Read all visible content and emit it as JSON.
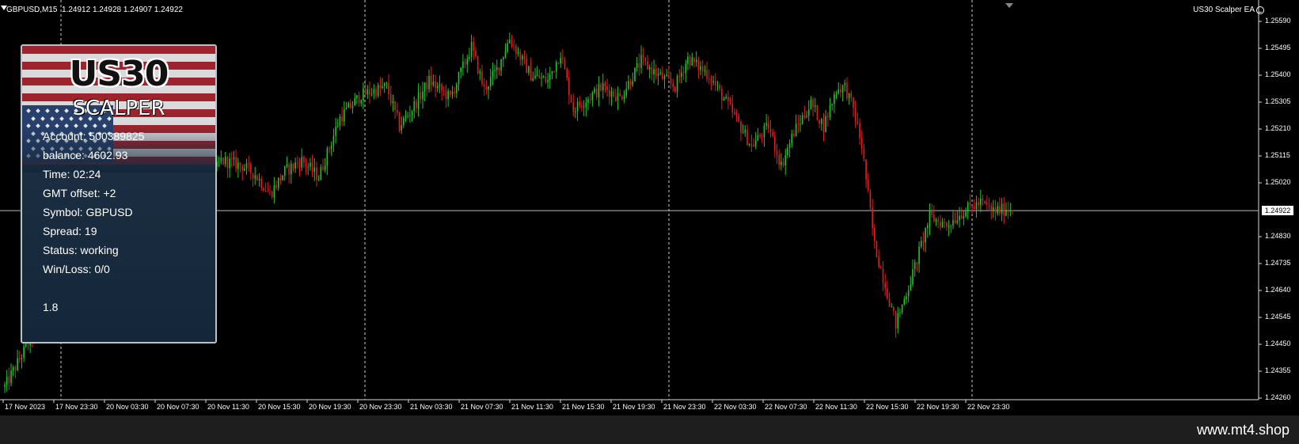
{
  "header": {
    "symbol": "GBPUSD,M15",
    "ohlc": "1.24912 1.24928 1.24907 1.24922",
    "ea_name": "US30 Scalper EA"
  },
  "price_axis": {
    "labels": [
      "1.25590",
      "1.25495",
      "1.25400",
      "1.25305",
      "1.25210",
      "1.25115",
      "1.25020",
      "1.24830",
      "1.24735",
      "1.24640",
      "1.24545",
      "1.24450",
      "1.24355",
      "1.24260"
    ],
    "current_price": "1.24922"
  },
  "time_axis": {
    "labels": [
      "17 Nov 2023",
      "17 Nov 23:30",
      "20 Nov 03:30",
      "20 Nov 07:30",
      "20 Nov 11:30",
      "20 Nov 15:30",
      "20 Nov 19:30",
      "20 Nov 23:30",
      "21 Nov 03:30",
      "21 Nov 07:30",
      "21 Nov 11:30",
      "21 Nov 15:30",
      "21 Nov 19:30",
      "21 Nov 23:30",
      "22 Nov 03:30",
      "22 Nov 07:30",
      "22 Nov 11:30",
      "22 Nov 15:30",
      "22 Nov 19:30",
      "22 Nov 23:30"
    ]
  },
  "panel": {
    "logo_line1": "US30",
    "logo_line2": "SCALPER",
    "account": "Account: 500389825",
    "balance": "balance: 4602.93",
    "time": "Time: 02:24",
    "gmt_offset": "GMT offset: +2",
    "symbol": "Symbol: GBPUSD",
    "spread": "Spread: 19",
    "status": "Status: working",
    "winloss": "Win/Loss: 0/0",
    "version": "1.8"
  },
  "footer": {
    "url": "www.mt4.shop"
  },
  "colors": {
    "bull": "#22c52a",
    "bear": "#e01e1e",
    "grid": "#cfcfcf",
    "background": "#000000"
  },
  "icons": [
    "menu-arrow-icon",
    "smiley-icon"
  ],
  "candle_series_waypoints": [
    [
      0,
      1.243
    ],
    [
      20,
      1.2458
    ],
    [
      35,
      1.2487
    ],
    [
      55,
      1.2472
    ],
    [
      70,
      1.2462
    ],
    [
      78,
      1.248
    ],
    [
      92,
      1.2496
    ],
    [
      102,
      1.251
    ],
    [
      112,
      1.2508
    ],
    [
      118,
      1.2505
    ],
    [
      125,
      1.2498
    ],
    [
      132,
      1.2506
    ],
    [
      140,
      1.251
    ],
    [
      148,
      1.2504
    ],
    [
      158,
      1.2525
    ],
    [
      168,
      1.2533
    ],
    [
      180,
      1.2536
    ],
    [
      186,
      1.2522
    ],
    [
      192,
      1.2528
    ],
    [
      200,
      1.2538
    ],
    [
      210,
      1.2532
    ],
    [
      220,
      1.255
    ],
    [
      226,
      1.2535
    ],
    [
      232,
      1.2542
    ],
    [
      238,
      1.2553
    ],
    [
      248,
      1.254
    ],
    [
      256,
      1.2538
    ],
    [
      262,
      1.2548
    ],
    [
      268,
      1.2528
    ],
    [
      275,
      1.2532
    ],
    [
      282,
      1.2536
    ],
    [
      290,
      1.2532
    ],
    [
      300,
      1.2545
    ],
    [
      308,
      1.254
    ],
    [
      316,
      1.2536
    ],
    [
      322,
      1.2546
    ],
    [
      332,
      1.254
    ],
    [
      342,
      1.2528
    ],
    [
      352,
      1.2515
    ],
    [
      360,
      1.2522
    ],
    [
      366,
      1.2508
    ],
    [
      372,
      1.252
    ],
    [
      380,
      1.253
    ],
    [
      386,
      1.2522
    ],
    [
      392,
      1.2535
    ],
    [
      396,
      1.2536
    ],
    [
      400,
      1.2528
    ],
    [
      404,
      1.2515
    ],
    [
      410,
      1.248
    ],
    [
      420,
      1.2452
    ],
    [
      428,
      1.247
    ],
    [
      436,
      1.249
    ],
    [
      444,
      1.2487
    ],
    [
      452,
      1.2492
    ],
    [
      460,
      1.2495
    ],
    [
      466,
      1.2492
    ],
    [
      475,
      1.2493
    ]
  ]
}
